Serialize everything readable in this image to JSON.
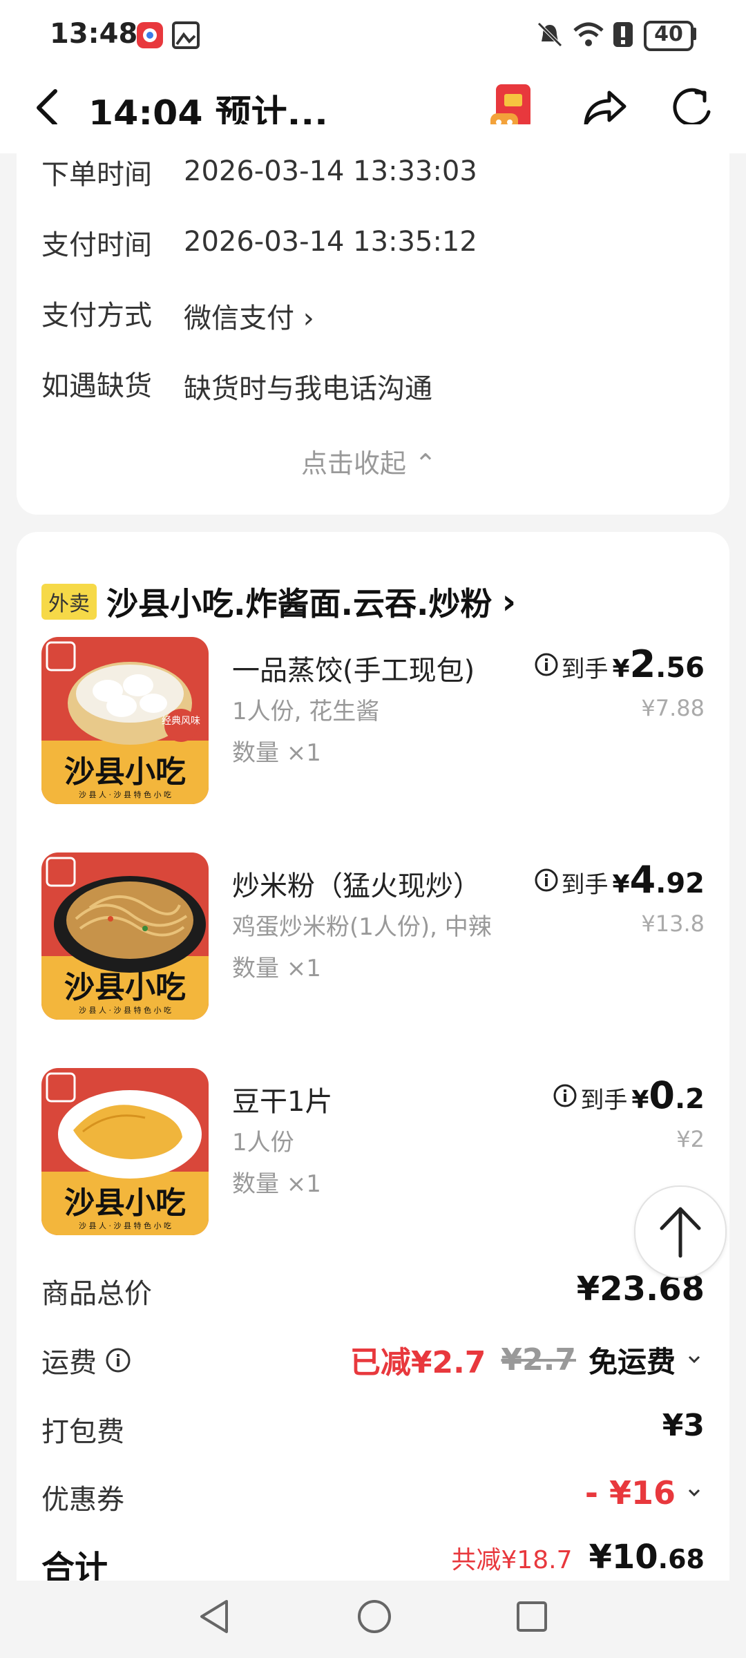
{
  "status_bar": {
    "time": "13:48",
    "battery": "40"
  },
  "header": {
    "title": "14:04 预计..."
  },
  "order_info": {
    "rows": [
      {
        "label": "下单时间",
        "value": "2026-03-14 13:33:03"
      },
      {
        "label": "支付时间",
        "value": "2026-03-14 13:35:12"
      },
      {
        "label": "支付方式",
        "value": "微信支付 ›"
      },
      {
        "label": "如遇缺货",
        "value": "缺货时与我电话沟通"
      }
    ],
    "collapse_label": "点击收起 ⌃"
  },
  "shop": {
    "tag": "外卖",
    "name": "沙县小吃.炸酱面.云吞.炒粉",
    "arrow": "›"
  },
  "thumbnail": {
    "brand": "沙县小吃",
    "slogan": "沙 县 人 · 沙 县 特 色 小 吃",
    "badge": "经典风味"
  },
  "items": [
    {
      "name": "一品蒸饺(手工现包)",
      "spec": "1人份, 花生酱",
      "qty": "数量 ×1",
      "pay_label": "到手",
      "yen": "¥",
      "int": "2",
      "dec": ".56",
      "orig": "¥7.88"
    },
    {
      "name": "炒米粉（猛火现炒）",
      "spec": "鸡蛋炒米粉(1人份), 中辣",
      "qty": "数量 ×1",
      "pay_label": "到手",
      "yen": "¥",
      "int": "4",
      "dec": ".92",
      "orig": "¥13.8"
    },
    {
      "name": "豆干1片",
      "spec": "1人份",
      "qty": "数量 ×1",
      "pay_label": "到手",
      "yen": "¥",
      "int": "0",
      "dec": ".2",
      "orig": "¥2"
    }
  ],
  "summary": {
    "goods_total_label": "商品总价",
    "goods_total": "¥23.68",
    "delivery_label": "运费",
    "delivery_reduced": "已减¥2.7",
    "delivery_orig": "¥2.7",
    "delivery_free": "免运费",
    "packing_label": "打包费",
    "packing": "¥3",
    "coupon_label": "优惠券",
    "coupon": "- ¥16",
    "total_label": "合计",
    "total_reduced": "共减¥18.7",
    "total_int": "¥10",
    "total_dec": ".68"
  },
  "colors": {
    "accent_red": "#e8383d",
    "tag_yellow": "#f6d948",
    "thumb_red": "#d9473a",
    "thumb_yellow": "#f3b63c"
  }
}
